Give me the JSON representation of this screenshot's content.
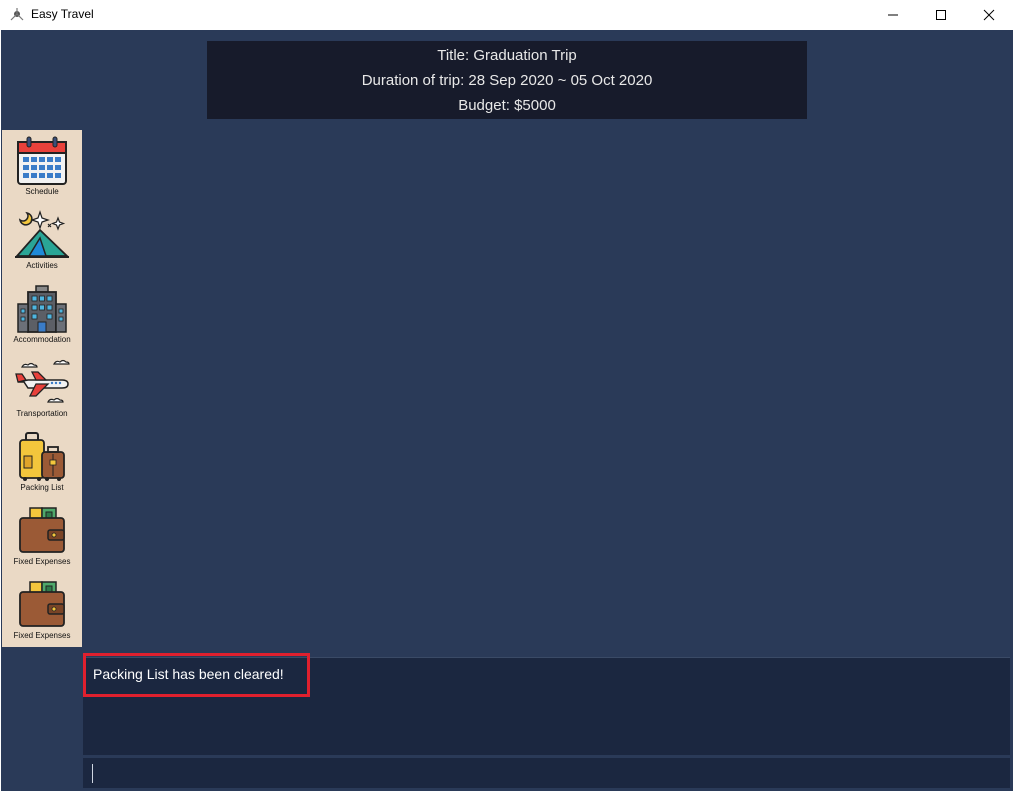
{
  "window": {
    "title": "Easy Travel"
  },
  "trip": {
    "title_line": "Title: Graduation Trip",
    "duration_line": "Duration of trip: 28 Sep 2020 ~ 05 Oct 2020",
    "budget_line": "Budget: $5000"
  },
  "sidebar": {
    "items": [
      {
        "label": "Schedule",
        "icon": "calendar-icon"
      },
      {
        "label": "Activities",
        "icon": "tent-icon"
      },
      {
        "label": "Accommodation",
        "icon": "hotel-icon"
      },
      {
        "label": "Transportation",
        "icon": "airplane-icon"
      },
      {
        "label": "Packing List",
        "icon": "luggage-icon"
      },
      {
        "label": "Fixed Expenses",
        "icon": "wallet-icon"
      },
      {
        "label": "Fixed Expenses",
        "icon": "wallet-icon"
      }
    ]
  },
  "result": {
    "message": "Packing List has been cleared!"
  },
  "command": {
    "value": ""
  },
  "colors": {
    "background": "#2a3a58",
    "header": "#171b2b",
    "sidebar": "#ead9c5",
    "highlight": "#e0202e"
  }
}
